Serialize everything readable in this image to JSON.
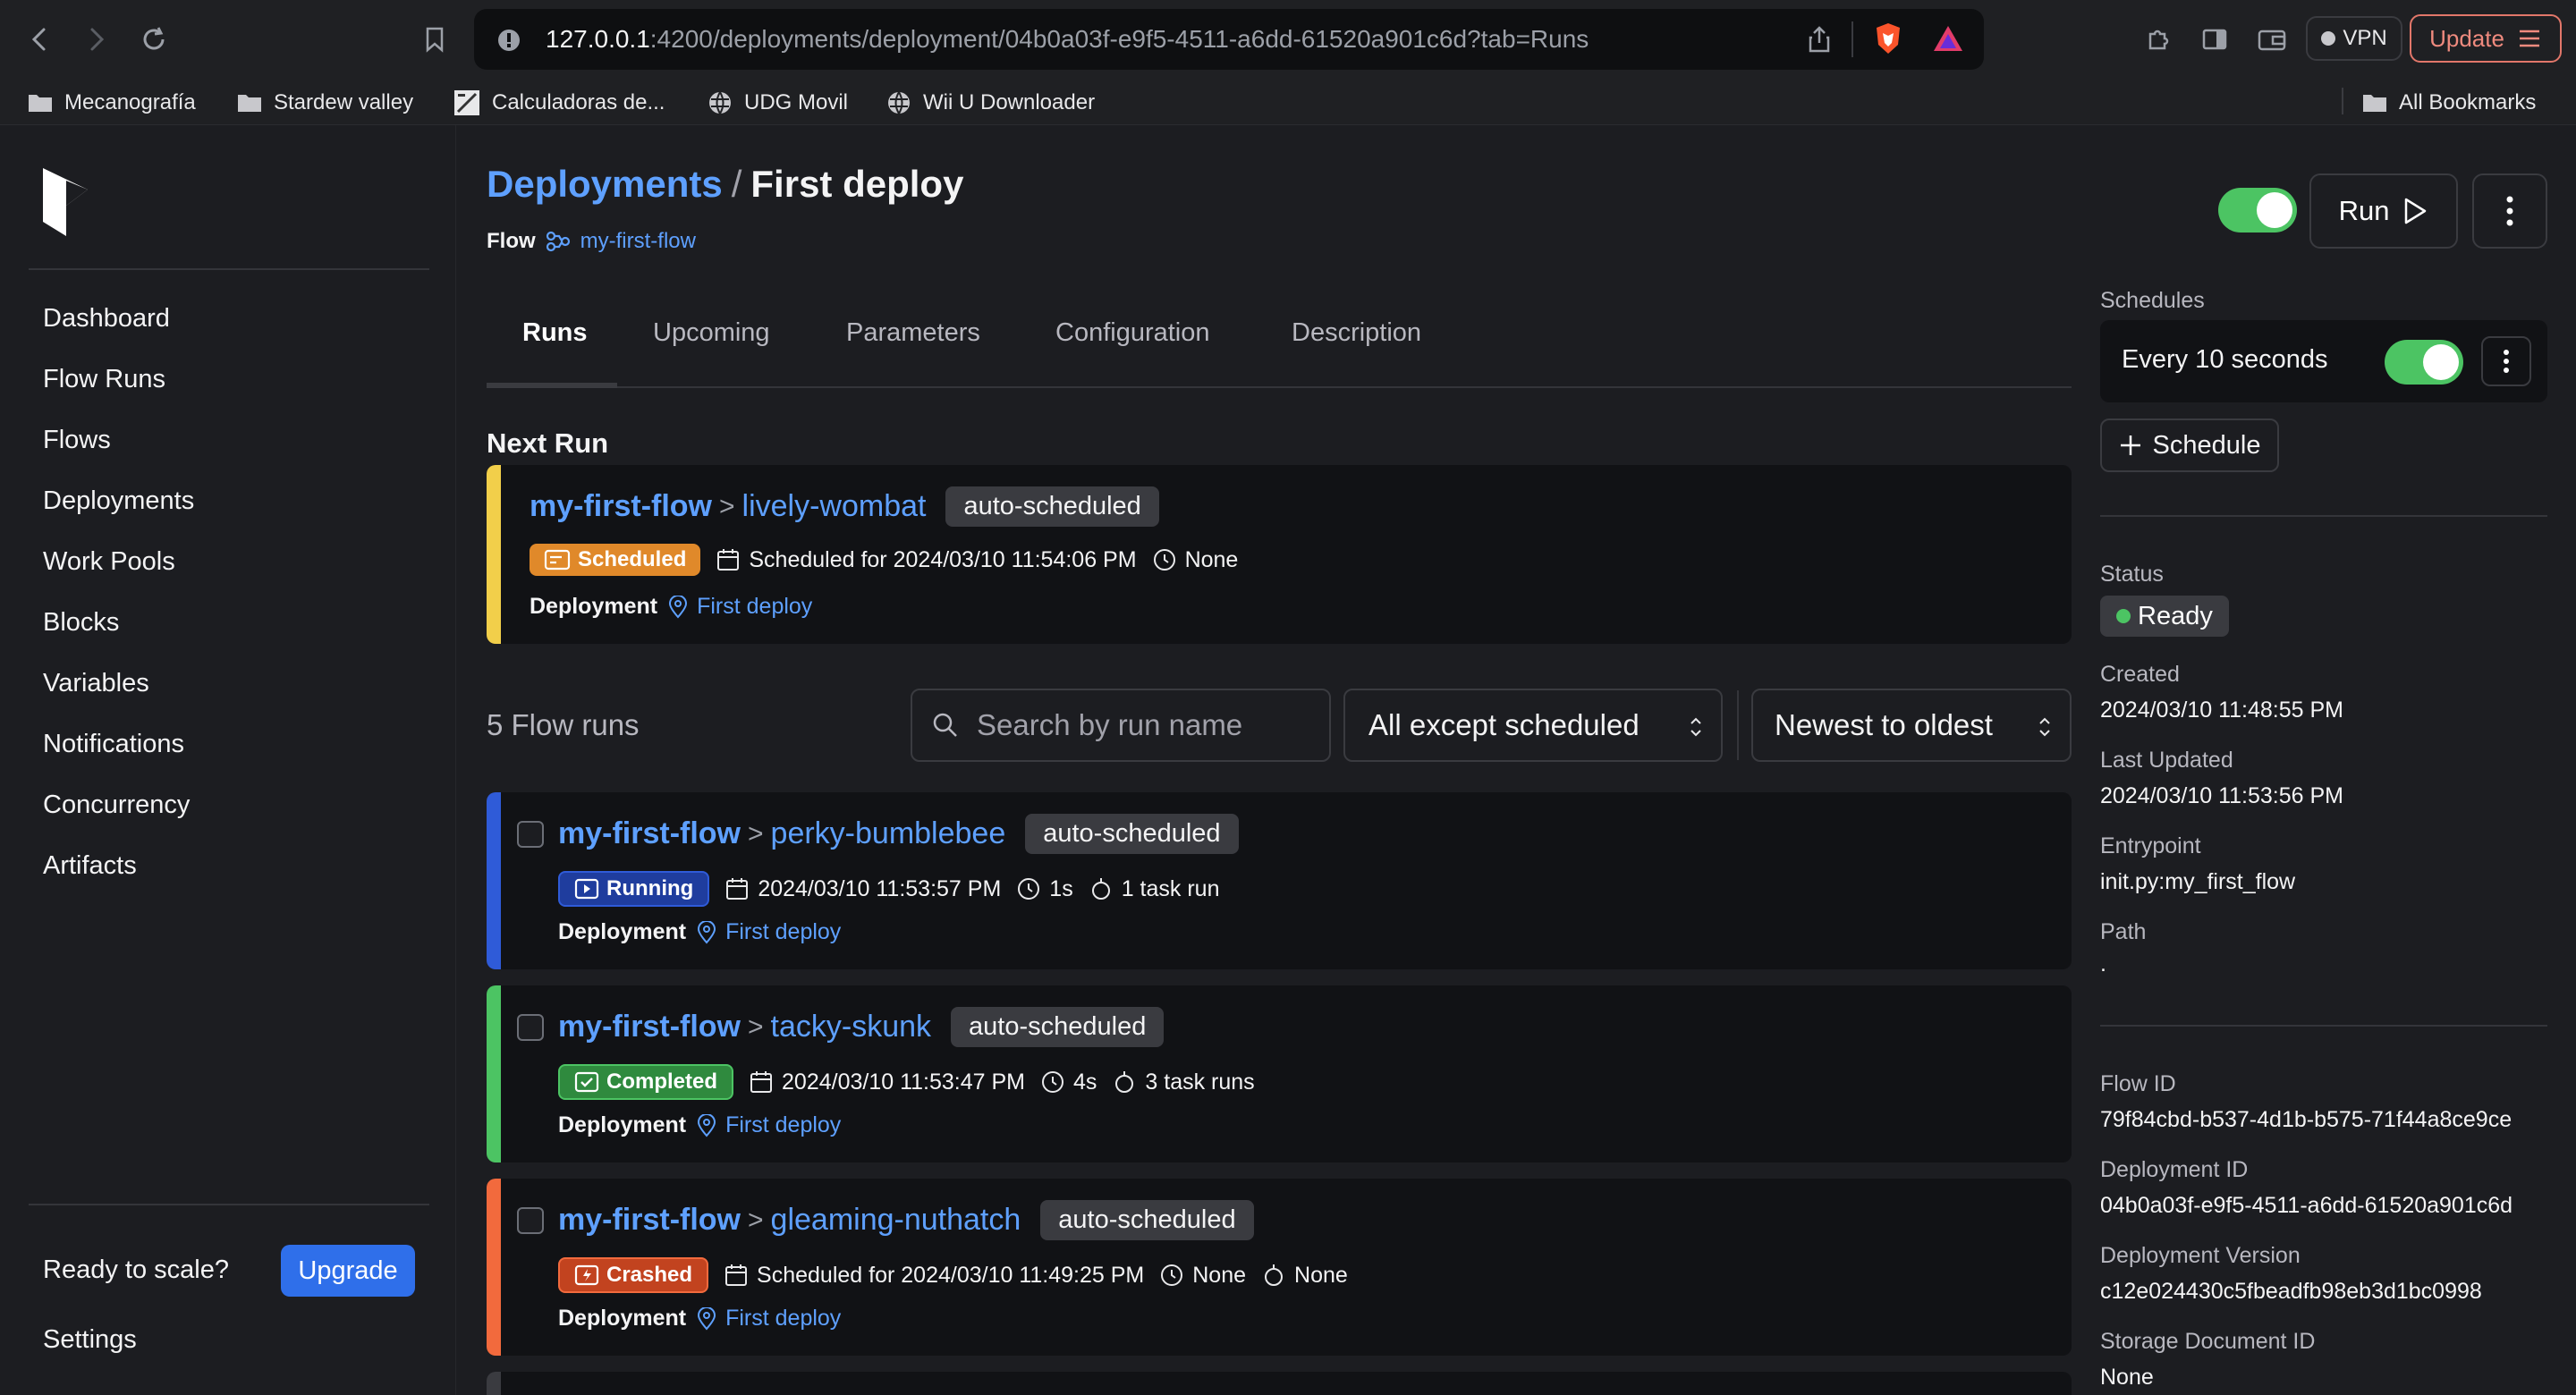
{
  "browser": {
    "url_host": "127.0.0.1",
    "url_path": ":4200/deployments/deployment/04b0a03f-e9f5-4511-a6dd-61520a901c6d?tab=Runs",
    "vpn_label": "VPN",
    "update_label": "Update",
    "bookmarks": [
      "Mecanografía",
      "Stardew valley",
      "Calculadoras de...",
      "UDG Movil",
      "Wii U Downloader"
    ],
    "all_bookmarks": "All Bookmarks"
  },
  "sidebar": {
    "items": [
      "Dashboard",
      "Flow Runs",
      "Flows",
      "Deployments",
      "Work Pools",
      "Blocks",
      "Variables",
      "Notifications",
      "Concurrency",
      "Artifacts"
    ],
    "ready_text": "Ready to scale?",
    "upgrade_label": "Upgrade",
    "settings_label": "Settings"
  },
  "header": {
    "breadcrumb_root": "Deployments",
    "breadcrumb_sep": "/",
    "title": "First deploy",
    "flow_label": "Flow",
    "flow_name": "my-first-flow",
    "run_label": "Run"
  },
  "tabs": [
    "Runs",
    "Upcoming",
    "Parameters",
    "Configuration",
    "Description"
  ],
  "next_run": {
    "heading": "Next Run",
    "flow": "my-first-flow",
    "name": "lively-wombat",
    "tag": "auto-scheduled",
    "state": "Scheduled",
    "when": "Scheduled for 2024/03/10 11:54:06 PM",
    "duration": "None",
    "deployment_label": "Deployment",
    "deployment": "First deploy"
  },
  "filters": {
    "count": "5 Flow runs",
    "search_placeholder": "Search by run name",
    "state_filter": "All except scheduled",
    "sort": "Newest to oldest"
  },
  "runs": [
    {
      "flow": "my-first-flow",
      "name": "perky-bumblebee",
      "tag": "auto-scheduled",
      "state": "Running",
      "when": "2024/03/10 11:53:57 PM",
      "duration": "1s",
      "tasks": "1 task run",
      "deployment_label": "Deployment",
      "deployment": "First deploy"
    },
    {
      "flow": "my-first-flow",
      "name": "tacky-skunk",
      "tag": "auto-scheduled",
      "state": "Completed",
      "when": "2024/03/10 11:53:47 PM",
      "duration": "4s",
      "tasks": "3 task runs",
      "deployment_label": "Deployment",
      "deployment": "First deploy"
    },
    {
      "flow": "my-first-flow",
      "name": "gleaming-nuthatch",
      "tag": "auto-scheduled",
      "state": "Crashed",
      "when": "Scheduled for 2024/03/10 11:49:25 PM",
      "duration": "None",
      "tasks": "None",
      "deployment_label": "Deployment",
      "deployment": "First deploy"
    }
  ],
  "details": {
    "schedules_label": "Schedules",
    "schedule_text": "Every 10 seconds",
    "add_schedule": "Schedule",
    "status_label": "Status",
    "status_value": "Ready",
    "created_label": "Created",
    "created_value": "2024/03/10 11:48:55 PM",
    "updated_label": "Last Updated",
    "updated_value": "2024/03/10 11:53:56 PM",
    "entrypoint_label": "Entrypoint",
    "entrypoint_value": "init.py:my_first_flow",
    "path_label": "Path",
    "path_value": ".",
    "flow_id_label": "Flow ID",
    "flow_id_value": "79f84cbd-b537-4d1b-b575-71f44a8ce9ce",
    "deployment_id_label": "Deployment ID",
    "deployment_id_value": "04b0a03f-e9f5-4511-a6dd-61520a901c6d",
    "version_label": "Deployment Version",
    "version_value": "c12e024430c5fbeadfb98eb3d1bc0998",
    "storage_label": "Storage Document ID",
    "storage_value": "None"
  },
  "colors": {
    "accent": "#5ea0ff",
    "scheduled": "#e0892a",
    "running": "#2f5bd8",
    "completed": "#4cc463",
    "crashed": "#f26a3d",
    "next_stripe": "#f2cf4a",
    "toggle": "#4cc463"
  }
}
